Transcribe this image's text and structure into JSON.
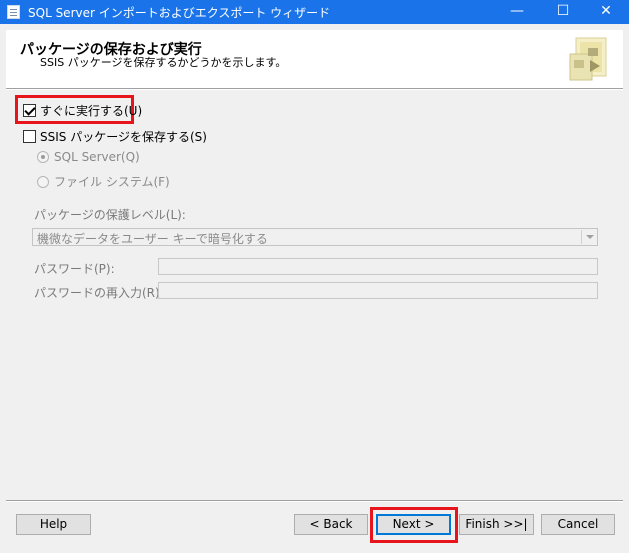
{
  "window": {
    "title": "SQL Server インポートおよびエクスポート ウィザード",
    "minimize": "—",
    "maximize": "☐",
    "close": "✕"
  },
  "header": {
    "title": "パッケージの保存および実行",
    "subtitle": "SSIS パッケージを保存するかどうかを示します。"
  },
  "options": {
    "run_immediately": {
      "label": "すぐに実行する(U)",
      "checked": true
    },
    "save_ssis": {
      "label": "SSIS パッケージを保存する(S)",
      "checked": false
    },
    "sql_server": {
      "label": "SQL Server(Q)",
      "selected": true
    },
    "file_system": {
      "label": "ファイル システム(F)",
      "selected": false
    }
  },
  "protection": {
    "label": "パッケージの保護レベル(L):",
    "value": "機微なデータをユーザー キーで暗号化する"
  },
  "password": {
    "label": "パスワード(P):",
    "value": ""
  },
  "password_confirm": {
    "label": "パスワードの再入力(R):",
    "value": ""
  },
  "buttons": {
    "help": "Help",
    "back": "< Back",
    "next": "Next >",
    "finish": "Finish >>|",
    "cancel": "Cancel"
  },
  "highlight_color": "#e8141c",
  "titlebar_color": "#1a73e8"
}
